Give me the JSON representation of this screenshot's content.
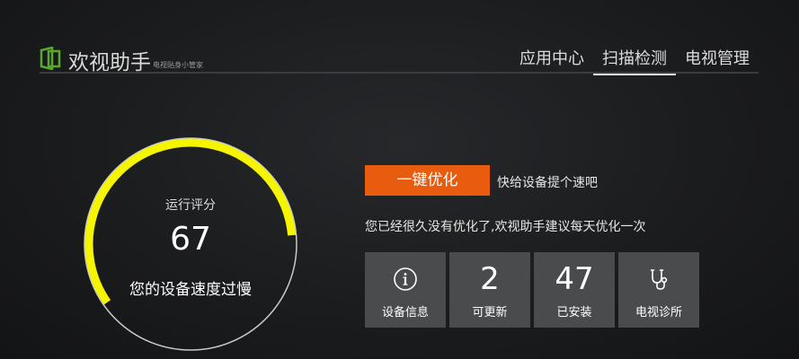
{
  "header": {
    "logo_icon": "tv-frame-icon",
    "title": "欢视助手",
    "subtitle": "电视贴身小管家",
    "nav": [
      {
        "label": "应用中心",
        "active": false
      },
      {
        "label": "扫描检测",
        "active": true
      },
      {
        "label": "电视管理",
        "active": false
      }
    ]
  },
  "score": {
    "label": "运行评分",
    "value": "67",
    "fraction": 0.67,
    "status": "您的设备速度过慢",
    "arc_color": "#f5f500"
  },
  "optimize": {
    "button_label": "一键优化",
    "button_color": "#e85c10",
    "hint": "快给设备提个速吧",
    "advice": "您已经很久没有优化了,欢视助手建议每天优化一次"
  },
  "tiles": [
    {
      "icon": "info-icon",
      "value": "",
      "label": "设备信息"
    },
    {
      "icon": "",
      "value": "2",
      "label": "可更新"
    },
    {
      "icon": "",
      "value": "47",
      "label": "已安装"
    },
    {
      "icon": "stethoscope-icon",
      "value": "",
      "label": "电视诊所"
    }
  ]
}
